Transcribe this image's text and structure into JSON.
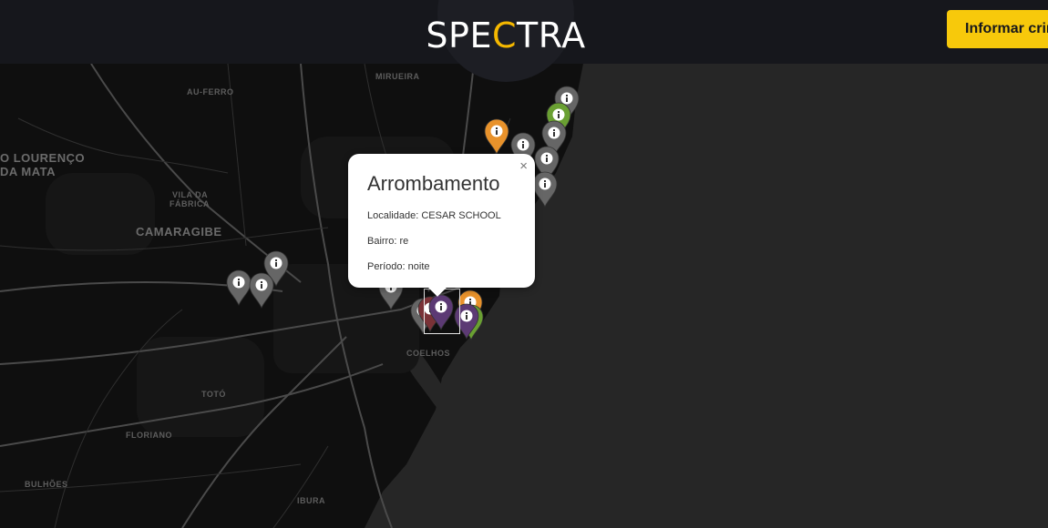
{
  "header": {
    "brand_pre": "SPE",
    "brand_accent": "C",
    "brand_post": "TRA",
    "report_button": "Informar crime"
  },
  "colors": {
    "brand_accent": "#f5b800",
    "button": "#f7c90b",
    "marker_gray": "#666666",
    "marker_orange": "#e8922b",
    "marker_green": "#6aa032",
    "marker_purple": "#5c3a74",
    "marker_red": "#7a3237"
  },
  "map": {
    "places": [
      {
        "id": "mirueira",
        "label": "MIRUEIRA"
      },
      {
        "id": "pau-ferro",
        "label": "AU-FERRO"
      },
      {
        "id": "sao-lourenco-1",
        "label": "O LOURENÇO"
      },
      {
        "id": "sao-lourenco-2",
        "label": "DA MATA"
      },
      {
        "id": "vila-da-fabrica-1",
        "label": "VILA DA"
      },
      {
        "id": "vila-da-fabrica-2",
        "label": "FÁBRICA"
      },
      {
        "id": "camaragibe",
        "label": "CAMARAGIBE"
      },
      {
        "id": "toto",
        "label": "TOTÓ"
      },
      {
        "id": "floriano",
        "label": "FLORIANO"
      },
      {
        "id": "bulhoes",
        "label": "BULHÕES"
      },
      {
        "id": "ibura",
        "label": "IBURA"
      },
      {
        "id": "coelhos",
        "label": "COELHOS"
      }
    ],
    "markers": [
      {
        "color": "gray"
      },
      {
        "color": "green"
      },
      {
        "color": "orange"
      },
      {
        "color": "gray"
      },
      {
        "color": "gray"
      },
      {
        "color": "gray"
      },
      {
        "color": "gray"
      },
      {
        "color": "gray"
      },
      {
        "color": "gray"
      },
      {
        "color": "gray"
      },
      {
        "color": "gray"
      },
      {
        "color": "gray"
      },
      {
        "color": "red"
      },
      {
        "color": "purple"
      },
      {
        "color": "orange"
      },
      {
        "color": "green"
      },
      {
        "color": "purple"
      }
    ],
    "marker_icon": "info-icon"
  },
  "popup": {
    "title": "Arrombamento",
    "locality": "Localidade: CESAR SCHOOL",
    "district": "Bairro: re",
    "period": "Período: noite",
    "close": "×"
  }
}
